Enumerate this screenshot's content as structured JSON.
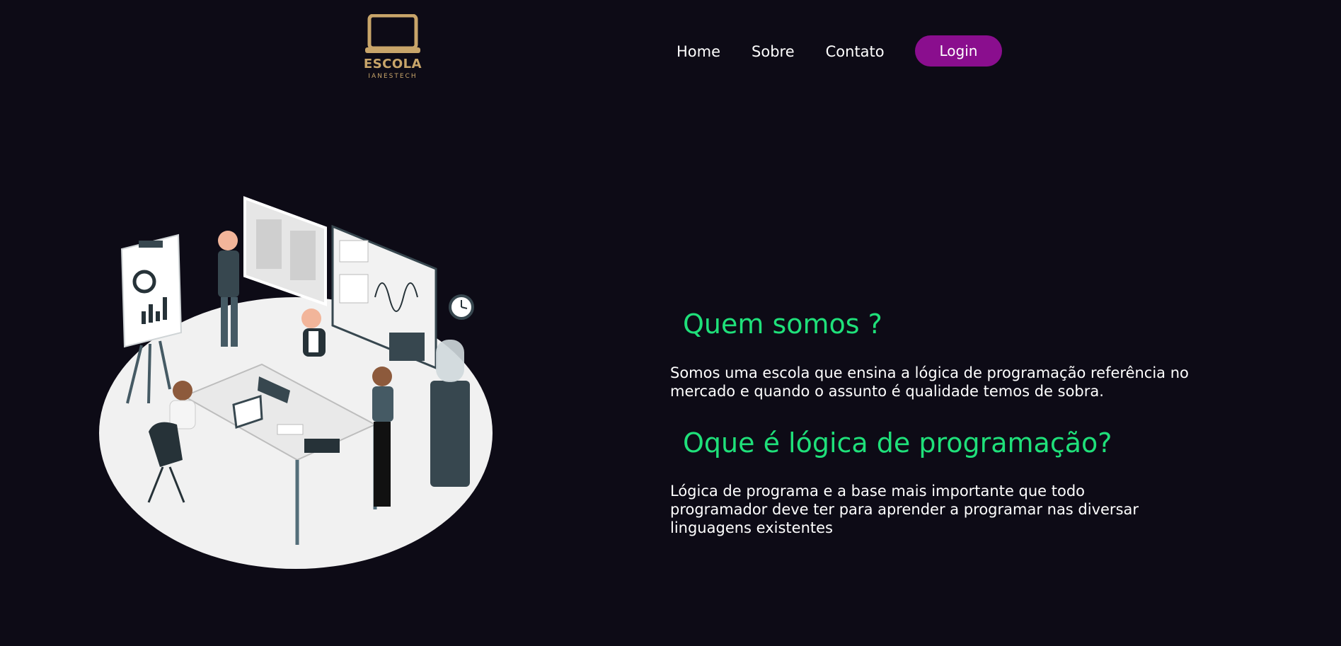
{
  "logo": {
    "title": "ESCOLA",
    "subtitle": "IANESTECH",
    "icon": "laptop-icon",
    "color": "#c8a56a"
  },
  "nav": {
    "items": [
      "Home",
      "Sobre",
      "Contato"
    ],
    "login_label": "Login",
    "login_color": "#8a0e8e"
  },
  "sections": [
    {
      "heading": "Quem somos ?",
      "text": "Somos uma escola que ensina a lógica de programação referência no mercado e quando o assunto é qualidade temos de sobra."
    },
    {
      "heading": "Oque é lógica de programação?",
      "text": "Lógica de programa e a base mais importante que todo programador deve ter para aprender a programar nas diversar linguagens existentes"
    }
  ],
  "colors": {
    "background": "#0d0b16",
    "heading": "#1fe07a",
    "text": "#ffffff"
  },
  "illustration": "team-meeting-illustration"
}
